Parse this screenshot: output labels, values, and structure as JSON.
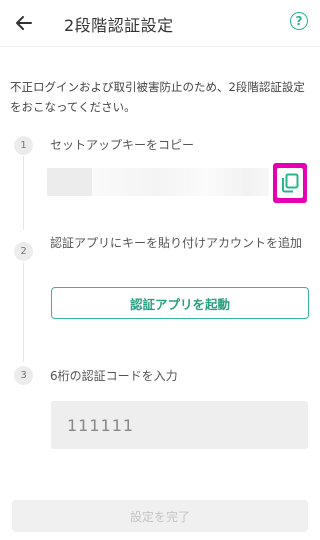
{
  "header": {
    "title": "2段階認証設定",
    "back_icon": "arrow-left-icon",
    "help_label": "?",
    "accent_color": "#2ab58f"
  },
  "description": "不正ログインおよび取引被害防止のため、2段階認証設定をおこなってください。",
  "steps": [
    {
      "number": "1",
      "label": "セットアップキーをコピー",
      "copy_icon": "copy-icon"
    },
    {
      "number": "2",
      "label": "認証アプリにキーを貼り付けアカウントを追加",
      "button_label": "認証アプリを起動"
    },
    {
      "number": "3",
      "label": "6桁の認証コードを入力",
      "input_value": "111111"
    }
  ],
  "complete_button_label": "設定を完了",
  "colors": {
    "highlight": "#e600b4",
    "accent": "#2ab58f",
    "disabled_text": "#c4c4c4"
  }
}
